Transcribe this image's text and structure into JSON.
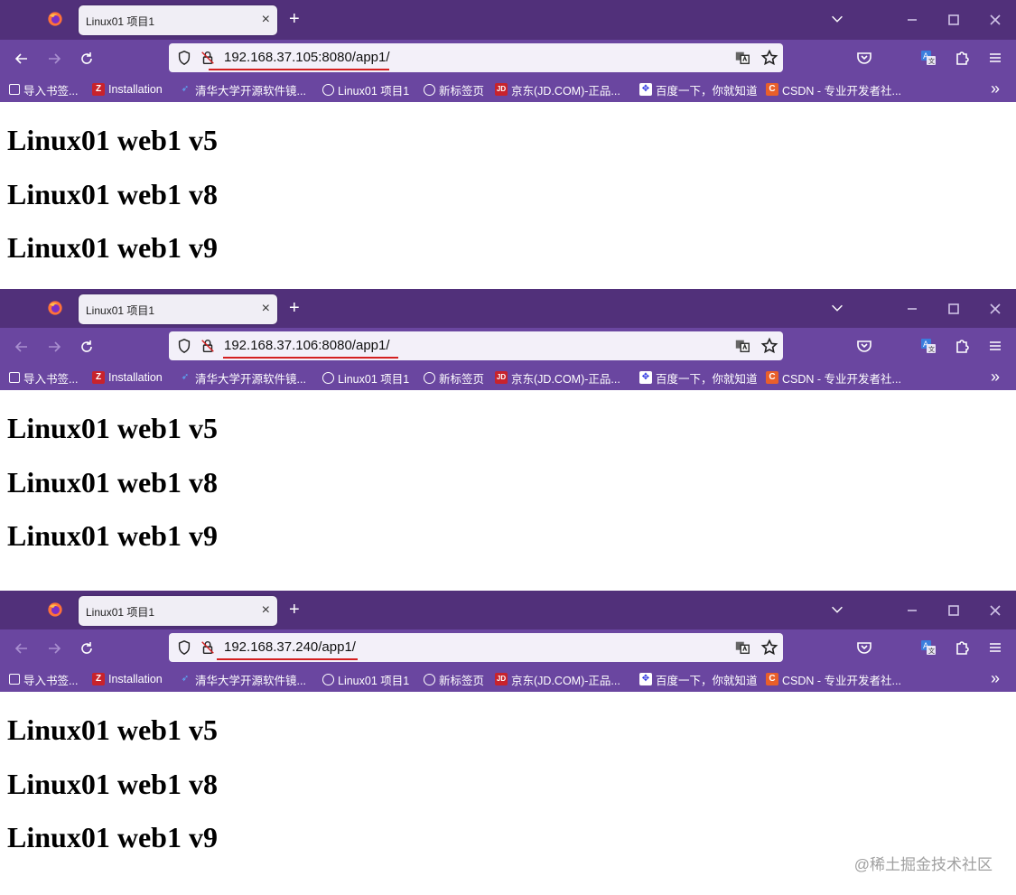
{
  "windows": [
    {
      "tab_title": "Linux01 项目1",
      "url": "192.168.37.105:8080/app1/",
      "headings": [
        "Linux01 web1 v5",
        "Linux01 web1 v8",
        "Linux01 web1 v9"
      ]
    },
    {
      "tab_title": "Linux01 项目1",
      "url": "192.168.37.106:8080/app1/",
      "headings": [
        "Linux01 web1 v5",
        "Linux01 web1 v8",
        "Linux01 web1 v9"
      ]
    },
    {
      "tab_title": "Linux01 项目1",
      "url": "192.168.37.240/app1/",
      "headings": [
        "Linux01 web1 v5",
        "Linux01 web1 v8",
        "Linux01 web1 v9"
      ]
    }
  ],
  "bookmarks": [
    "导入书签...",
    "Installation",
    "清华大学开源软件镜...",
    "Linux01 项目1",
    "新标签页",
    "京东(JD.COM)-正品...",
    "百度一下，你就知道",
    "CSDN - 专业开发者社..."
  ],
  "bookmark_icon_letters": {
    "installation": "Z",
    "jd": "JD",
    "csdn": "C"
  },
  "watermark": "@稀土掘金技术社区",
  "colors": {
    "titlebar": "#51307a",
    "toolbar": "#6a46a0",
    "url_underline": "#d42020"
  }
}
